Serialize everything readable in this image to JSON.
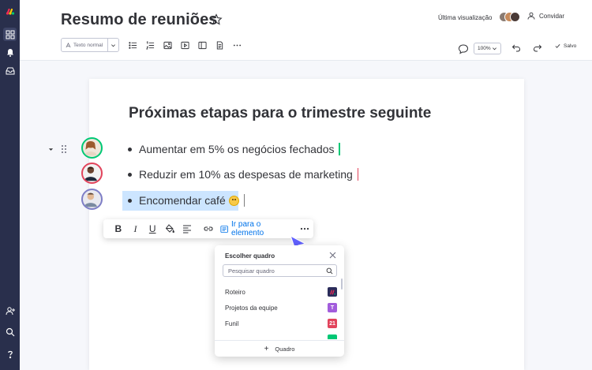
{
  "header": {
    "title": "Resumo de reuniões",
    "last_view_label": "Última visualização",
    "invite_label": "Convidar"
  },
  "toolbar": {
    "text_style": "Texto normal",
    "zoom": "100%",
    "saved_label": "Salvo"
  },
  "document": {
    "heading": "Próximas etapas para o trimestre seguinte",
    "bullets": [
      {
        "text": "Aumentar em 5% os negócios fechados",
        "cursor_color": "#00c875"
      },
      {
        "text": "Reduzir em 10% as despesas de marketing",
        "cursor_color": "#e2445c"
      },
      {
        "text": "Encomendar café",
        "cursor_color": "#7e7e7e"
      }
    ]
  },
  "format_toolbar": {
    "goto_label": "Ir para o elemento"
  },
  "board_chooser": {
    "title": "Escolher quadro",
    "search_placeholder": "Pesquisar quadro",
    "items": [
      {
        "label": "Roteiro",
        "badge": "",
        "color": "#2b2c5a"
      },
      {
        "label": "Projetos da equipe",
        "badge": "T",
        "color": "#a25ddc"
      },
      {
        "label": "Funil",
        "badge": "21",
        "color": "#e2445c"
      },
      {
        "label": "",
        "badge": "",
        "color": "#00c875"
      }
    ],
    "footer_label": "Quadro"
  },
  "colors": {
    "sidebar": "#292f4c",
    "accent": "#0073ea",
    "selection": "#cce5ff"
  }
}
